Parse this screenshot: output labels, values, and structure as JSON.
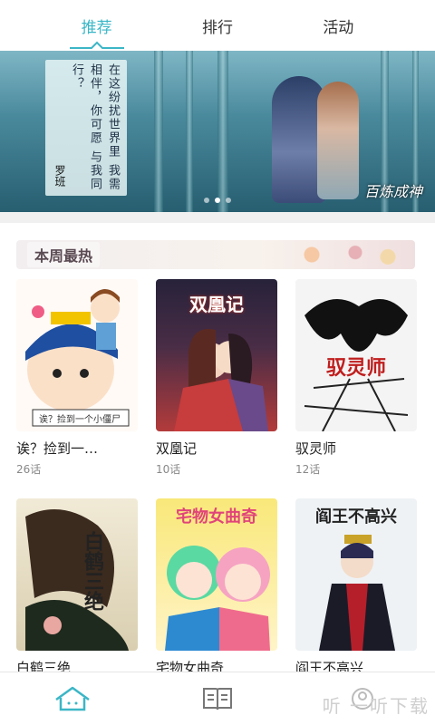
{
  "tabs": [
    {
      "label": "推荐",
      "active": true
    },
    {
      "label": "排行",
      "active": false
    },
    {
      "label": "活动",
      "active": false
    }
  ],
  "banner": {
    "poem": "在这纷扰世界里 我需相伴，你可愿 与我同行？",
    "signature": "罗班",
    "logo": "百炼成神",
    "dots": 3,
    "active_dot": 1
  },
  "section": {
    "title": "本周最热"
  },
  "comics": [
    {
      "name": "诶？捡到一…",
      "chapters": "26话",
      "cover_caption": "诶？捡到一个小僵尸"
    },
    {
      "name": "双凰记",
      "chapters": "10话",
      "cover_title": "双凰记"
    },
    {
      "name": "驭灵师",
      "chapters": "12话",
      "cover_title": "驭灵师"
    },
    {
      "name": "白鹤三绝",
      "chapters": "",
      "cover_title": "白鹤三绝"
    },
    {
      "name": "宅物女曲奇",
      "chapters": "",
      "cover_title": "宅物女曲奇"
    },
    {
      "name": "阎王不高兴",
      "chapters": "",
      "cover_title": "阎王不高兴"
    }
  ],
  "bottom_nav": [
    {
      "icon": "home-icon",
      "active": true
    },
    {
      "icon": "book-icon",
      "active": false
    },
    {
      "icon": "profile-icon",
      "active": false
    }
  ],
  "watermark": "听 一听下载",
  "colors": {
    "accent": "#3bb6c6"
  }
}
